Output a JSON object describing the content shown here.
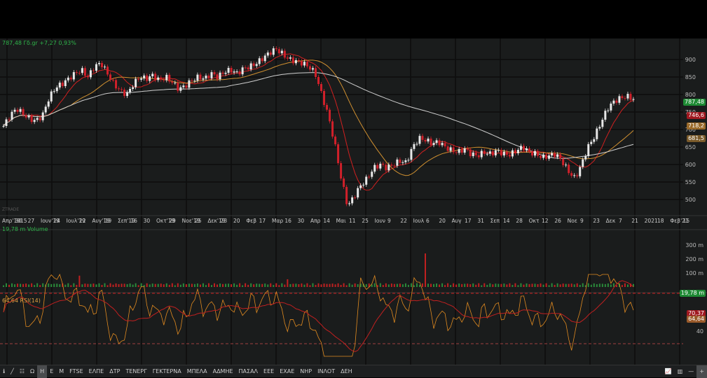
{
  "header": {
    "quote": "787,48 Γδ.gr +7,27 0,93%"
  },
  "watermark": "ZTRADE",
  "price_axis": {
    "ticks": [
      "900",
      "850",
      "800",
      "750",
      "700",
      "650",
      "600",
      "550",
      "500"
    ]
  },
  "price_tags": [
    {
      "text": "787,48",
      "color": "#1e8a34"
    },
    {
      "text": "746,6",
      "color": "#a01820"
    },
    {
      "text": "718,2",
      "color": "#9a6a2a"
    },
    {
      "text": "681,5",
      "color": "#7a5a2a"
    }
  ],
  "time_axis": [
    "Απρ'1915",
    "30",
    "27",
    "Ιουν'19",
    "24",
    "Ιουλ'19",
    "22",
    "Αυγ'19",
    "19",
    "Σεπ'19",
    "16",
    "30",
    "Οκτ'19",
    "29",
    "Νοε'19",
    "25",
    "Δεκ'19",
    "23",
    "20",
    "Φεβ",
    "17",
    "Μαρ",
    "16",
    "30",
    "Απρ",
    "14",
    "Μαι",
    "11",
    "25",
    "Ιουν",
    "9",
    "22",
    "Ιουλ",
    "6",
    "20",
    "Αυγ",
    "17",
    "31",
    "Σεπ",
    "14",
    "28",
    "Οκτ",
    "12",
    "26",
    "Νοε",
    "9",
    "23",
    "Δεκ",
    "7",
    "21",
    "2021",
    "18",
    "Φεβ'21",
    "15"
  ],
  "volume": {
    "label": "19,78 m Volume",
    "ticks": [
      "300 m",
      "200 m",
      "100 m"
    ],
    "tag": "19,78 m"
  },
  "rsi": {
    "label": "64,64 RSI(14)",
    "ticks": [
      "40"
    ],
    "tags": [
      {
        "text": "70,37",
        "color": "#a01820"
      },
      {
        "text": "64,64",
        "color": "#9a5a2a"
      }
    ]
  },
  "closes": [
    710,
    740,
    760,
    745,
    730,
    725,
    740,
    790,
    820,
    830,
    845,
    860,
    870,
    850,
    880,
    890,
    860,
    830,
    810,
    800,
    830,
    850,
    845,
    855,
    840,
    850,
    835,
    815,
    825,
    840,
    850,
    845,
    860,
    850,
    865,
    870,
    860,
    875,
    880,
    890,
    905,
    920,
    930,
    915,
    900,
    895,
    890,
    880,
    860,
    800,
    740,
    660,
    560,
    480,
    510,
    540,
    560,
    590,
    600,
    590,
    600,
    610,
    605,
    650,
    675,
    670,
    660,
    665,
    650,
    640,
    635,
    645,
    630,
    625,
    635,
    630,
    640,
    630,
    628,
    640,
    650,
    635,
    630,
    620,
    625,
    630,
    610,
    580,
    560,
    600,
    650,
    680,
    720,
    760,
    780,
    790,
    795,
    787
  ],
  "toolbar": {
    "items": [
      "Ω",
      "Η",
      "Ε",
      "Μ",
      "FTSE",
      "ΕΛΠΕ",
      "ΔΤΡ",
      "ΤΕΝΕΡΓ",
      "ΓΕΚΤΕΡΝΑ",
      "ΜΠΕΛΑ",
      "ΑΔΜΗΕ",
      "ΠΑΣΑΛ",
      "ΕΕΕ",
      "ΕΧΑΕ",
      "ΝΗΡ",
      "ΙΝΛΟΤ",
      "ΔΕΗ"
    ],
    "active": "Η"
  }
}
